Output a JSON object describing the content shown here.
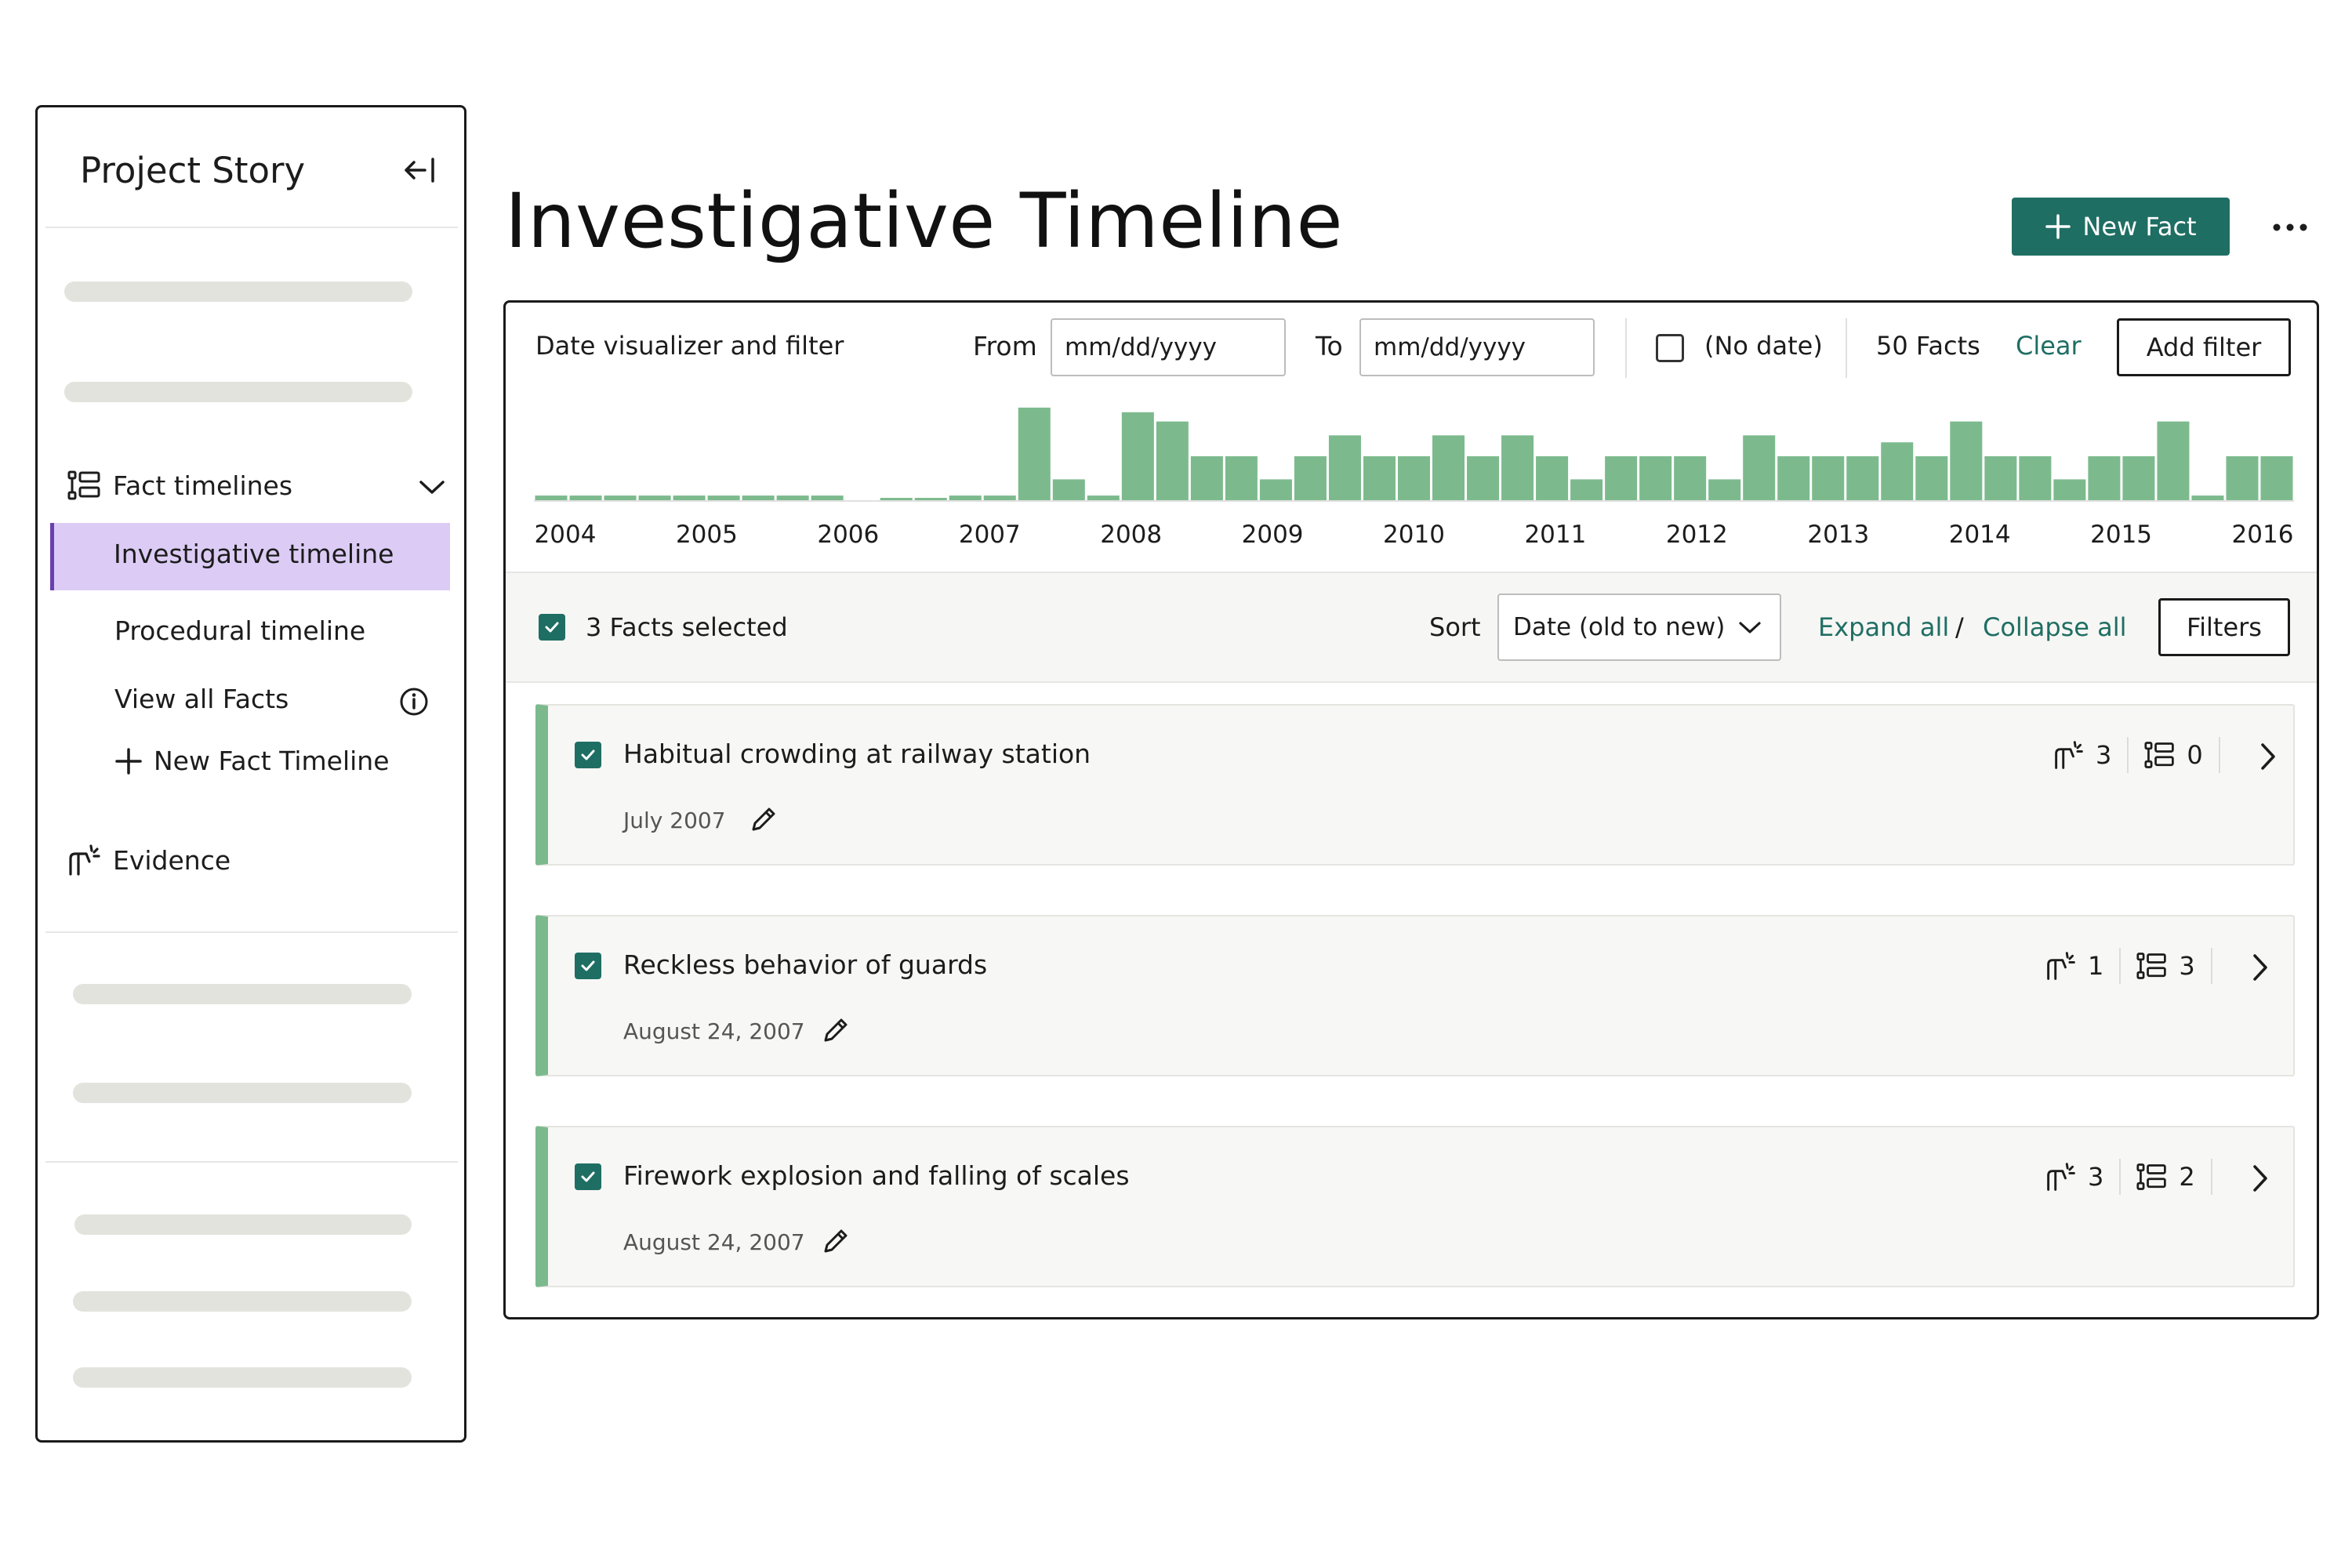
{
  "sidebar": {
    "title": "Project Story",
    "sections": {
      "fact_timelines": "Fact timelines",
      "evidence": "Evidence"
    },
    "items": [
      {
        "label": "Investigative timeline",
        "active": true
      },
      {
        "label": "Procedural timeline",
        "active": false
      },
      {
        "label": "View all Facts",
        "active": false
      }
    ],
    "new_timeline_label": "New Fact Timeline"
  },
  "header": {
    "title": "Investigative Timeline",
    "new_fact_label": "New Fact"
  },
  "filter": {
    "label": "Date visualizer and filter",
    "from_label": "From",
    "from_placeholder": "mm/dd/yyyy",
    "to_label": "To",
    "to_placeholder": "mm/dd/yyyy",
    "no_date_label": "(No date)",
    "no_date_checked": false,
    "facts_count": "50 Facts",
    "clear_label": "Clear",
    "add_filter_label": "Add filter"
  },
  "chart_data": {
    "type": "bar",
    "x_tick_labels": [
      "2004",
      "2005",
      "2006",
      "2007",
      "2008",
      "2009",
      "2010",
      "2011",
      "2012",
      "2013",
      "2014",
      "2015",
      "2016"
    ],
    "values": [
      0.2,
      0.2,
      0.2,
      0.2,
      0.2,
      0.2,
      0.2,
      0.2,
      0.2,
      0,
      0.1,
      0.1,
      0.2,
      0.2,
      4,
      0.9,
      0.2,
      3.8,
      3.4,
      1.9,
      1.9,
      0.9,
      1.9,
      2.8,
      1.9,
      1.9,
      2.8,
      1.9,
      2.8,
      1.9,
      0.9,
      1.9,
      1.9,
      1.9,
      0.9,
      2.8,
      1.9,
      1.9,
      1.9,
      2.5,
      1.9,
      3.4,
      1.9,
      1.9,
      0.9,
      1.9,
      1.9,
      3.4,
      0.2,
      1.9,
      1.9
    ],
    "ylim": [
      0,
      4.2
    ],
    "bar_color": "#7cba8d",
    "baseline_color": "#e0e0e0"
  },
  "toolbar": {
    "selected_label": "3 Facts selected",
    "sort_label": "Sort",
    "sort_value": "Date (old to new)",
    "expand_all": "Expand all",
    "slash": "/",
    "collapse_all": "Collapse all",
    "filters_label": "Filters"
  },
  "facts": [
    {
      "title": "Habitual crowding at railway station",
      "date": "July 2007",
      "evidence_count": "3",
      "timeline_count": "0",
      "checked": true
    },
    {
      "title": "Reckless behavior of guards",
      "date": "August 24, 2007",
      "evidence_count": "1",
      "timeline_count": "3",
      "checked": true
    },
    {
      "title": "Firework explosion and falling of scales",
      "date": "August 24, 2007",
      "evidence_count": "3",
      "timeline_count": "2",
      "checked": true
    }
  ],
  "colors": {
    "accent": "#1f6e63",
    "active_nav_bg": "#dcccf5",
    "active_nav_border": "#6a3fb0",
    "card_stripe": "#7cba8d",
    "skeleton": "#e3e3de"
  },
  "icons": [
    "collapse-sidebar-icon",
    "timeline-icon",
    "chevron-down-icon",
    "info-icon",
    "plus-icon",
    "evidence-icon",
    "more-icon",
    "check-icon",
    "edit-icon",
    "chevron-right-icon"
  ]
}
